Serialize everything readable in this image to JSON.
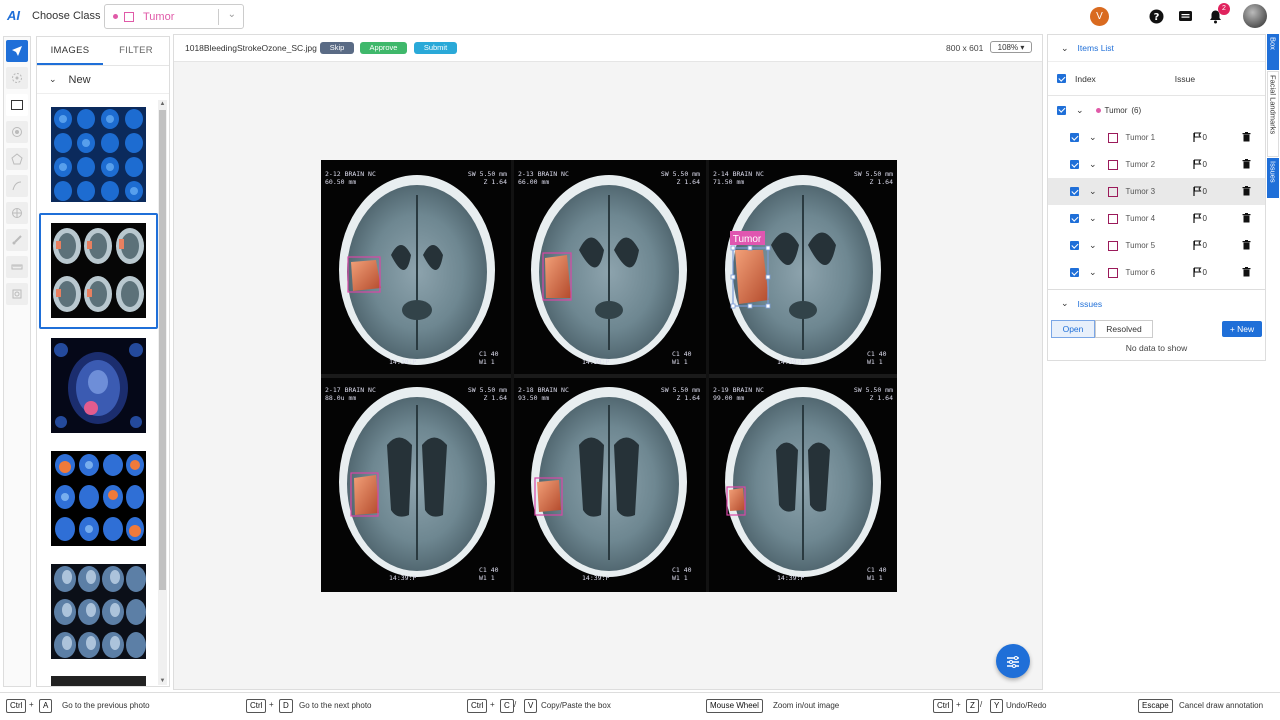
{
  "topbar": {
    "logo": "AI",
    "choose_class_label": "Choose Class",
    "selected_class": "Tumor",
    "user_initial": "V",
    "notification_count": "2"
  },
  "left_panel": {
    "tabs": [
      "IMAGES",
      "FILTER"
    ],
    "group_label": "New"
  },
  "canvas": {
    "filename": "1018BleedingStrokeOzone_SC.jpg",
    "skip_label": "Skip",
    "approve_label": "Approve",
    "submit_label": "Submit",
    "dimensions": "800 x 601",
    "zoom": "108%",
    "selected_annotation_label": "Tumor",
    "ct_panels": [
      {
        "line1": "2-12 BRAIN  NC",
        "line2": "60.50 mm",
        "r1": "SW 5.50 mm",
        "r2": "Z  1.64",
        "time": "14:39:P",
        "c": "C1  40",
        "w": "W1  1"
      },
      {
        "line1": "2-13 BRAIN  NC",
        "line2": "66.00 mm",
        "r1": "SW 5.50 mm",
        "r2": "Z  1.64",
        "time": "14:39:P",
        "c": "C1  40",
        "w": "W1  1"
      },
      {
        "line1": "2-14 BRAIN  NC",
        "line2": "71.50 mm",
        "r1": "SW 5.50 mm",
        "r2": "Z  1.64",
        "time": "14:39:P",
        "c": "C1  40",
        "w": "W1  1"
      },
      {
        "line1": "2-17 BRAIN  NC",
        "line2": "88.0u mm",
        "r1": "SW 5.50 mm",
        "r2": "Z  1.64",
        "time": "14:39:P",
        "c": "C1  40",
        "w": "W1  1"
      },
      {
        "line1": "2-18 BRAIN  NC",
        "line2": "93.50 mm",
        "r1": "SW 5.50 mm",
        "r2": "Z  1.64",
        "time": "14:39:P",
        "c": "C1  40",
        "w": "W1  1"
      },
      {
        "line1": "2-19 BRAIN  NC",
        "line2": "99.00 mm",
        "r1": "SW 5.50 mm",
        "r2": "Z  1.64",
        "time": "14:39:P",
        "c": "C1  40",
        "w": "W1  1"
      }
    ]
  },
  "items_panel": {
    "title": "Items List",
    "col_index": "Index",
    "col_issue": "Issue",
    "group_name": "Tumor",
    "group_count": "(6)",
    "items": [
      {
        "label": "Tumor 1",
        "flags": "0"
      },
      {
        "label": "Tumor 2",
        "flags": "0"
      },
      {
        "label": "Tumor 3",
        "flags": "0"
      },
      {
        "label": "Tumor 4",
        "flags": "0"
      },
      {
        "label": "Tumor 5",
        "flags": "0"
      },
      {
        "label": "Tumor 6",
        "flags": "0"
      }
    ]
  },
  "issues_panel": {
    "title": "Issues",
    "tab_open": "Open",
    "tab_resolved": "Resolved",
    "new_label": "+ New",
    "empty_text": "No data to show"
  },
  "side_tabs": [
    "Box",
    "Facial Landmarks",
    "Issues"
  ],
  "shortcuts": [
    {
      "keys": [
        "Ctrl",
        "A"
      ],
      "desc": "Go to the previous photo"
    },
    {
      "keys": [
        "Ctrl",
        "D"
      ],
      "desc": "Go to the next photo"
    },
    {
      "keys": [
        "Ctrl",
        "C",
        "V"
      ],
      "desc": "Copy/Paste the box"
    },
    {
      "keys": [
        "Mouse Wheel"
      ],
      "desc": "Zoom in/out image"
    },
    {
      "keys": [
        "Ctrl",
        "Z",
        "Y"
      ],
      "desc": "Undo/Redo"
    },
    {
      "keys": [
        "Escape"
      ],
      "desc": "Cancel draw annotation"
    }
  ],
  "colors": {
    "accent": "#1f6fd8",
    "class_color": "#e05aa8",
    "skip": "#5a6b85",
    "approve": "#3fb86b",
    "submit": "#2aa9d8"
  }
}
